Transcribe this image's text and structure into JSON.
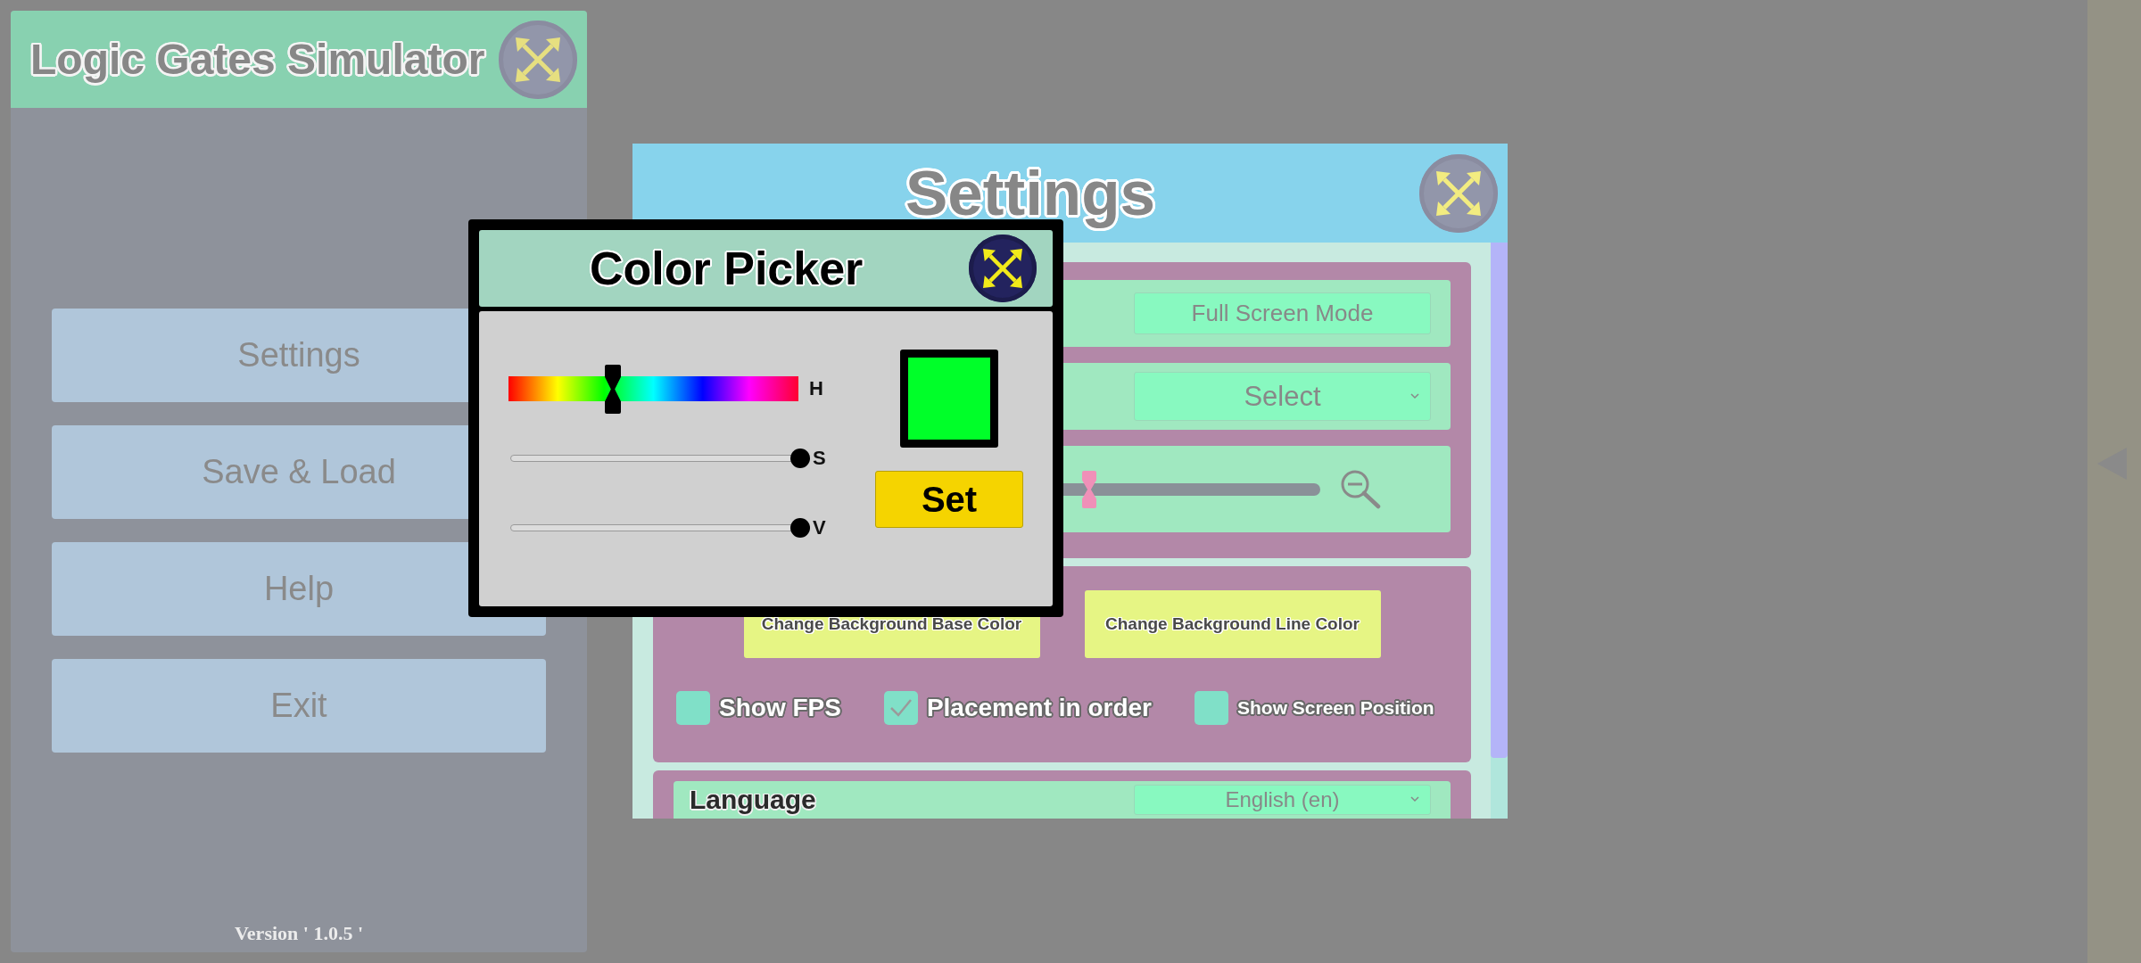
{
  "main_menu": {
    "title": "Logic Gates Simulator",
    "buttons": [
      {
        "label": "Settings"
      },
      {
        "label": "Save & Load"
      },
      {
        "label": "Help"
      },
      {
        "label": "Exit"
      }
    ],
    "version": "Version ' 1.0.5 '"
  },
  "settings": {
    "title": "Settings",
    "sections": [
      {
        "kind": "rows",
        "rows": [
          {
            "kind": "button",
            "button": "Full Screen Mode"
          },
          {
            "kind": "select",
            "value": "Select"
          },
          {
            "kind": "slider",
            "level": 0.46
          }
        ]
      },
      {
        "kind": "display",
        "buttons": [
          "Change Background Base Color",
          "Change Background Line Color"
        ],
        "checkboxes": [
          {
            "label": "Show FPS",
            "checked": false
          },
          {
            "label": "Placement in order",
            "checked": true
          },
          {
            "label": "Show Screen Position",
            "checked": false
          }
        ]
      },
      {
        "kind": "rows",
        "rows": [
          {
            "kind": "select",
            "label": "Language",
            "value": "English (en)"
          }
        ]
      }
    ]
  },
  "color_picker": {
    "title": "Color Picker",
    "sliders": [
      {
        "kind": "hue",
        "label": "H",
        "level": 0.36
      },
      {
        "kind": "plain",
        "label": "S",
        "level": 1
      },
      {
        "kind": "plain",
        "label": "V",
        "level": 1
      }
    ],
    "button": "Set"
  }
}
